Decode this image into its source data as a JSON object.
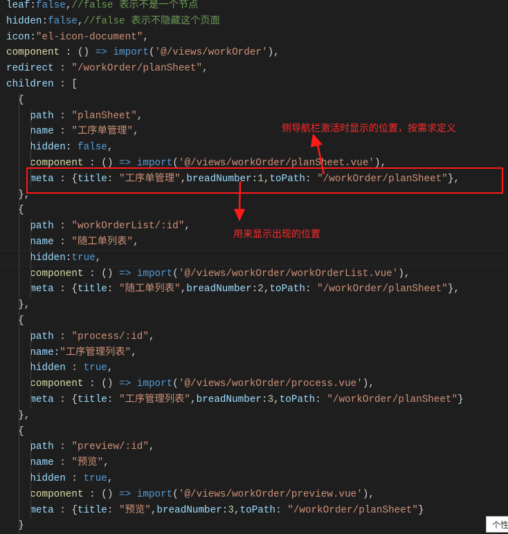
{
  "colors": {
    "background": "#1e1e1e",
    "annotation": "#ff1a1a"
  },
  "code_lines": [
    [
      [
        "key",
        "leaf"
      ],
      [
        "p",
        ":"
      ],
      [
        "kw",
        "false"
      ],
      [
        "p",
        ","
      ],
      [
        "cm",
        "//false 表示不是一个节点"
      ]
    ],
    [
      [
        "key",
        "hidden"
      ],
      [
        "p",
        ":"
      ],
      [
        "kw",
        "false"
      ],
      [
        "p",
        ","
      ],
      [
        "cm",
        "//false 表示不隐藏这个页面"
      ]
    ],
    [
      [
        "key",
        "icon"
      ],
      [
        "p",
        ":"
      ],
      [
        "str",
        "\"el-icon-document\""
      ],
      [
        "p",
        ","
      ]
    ],
    [
      [
        "fn",
        "component"
      ],
      [
        "p",
        " : () "
      ],
      [
        "kw",
        "=>"
      ],
      [
        "p",
        " "
      ],
      [
        "kw",
        "import"
      ],
      [
        "p",
        "("
      ],
      [
        "str",
        "'@/views/workOrder'"
      ],
      [
        "p",
        "),"
      ]
    ],
    [
      [
        "key",
        "redirect"
      ],
      [
        "p",
        " : "
      ],
      [
        "str",
        "\"/workOrder/planSheet\""
      ],
      [
        "p",
        ","
      ]
    ],
    [
      [
        "key",
        "children"
      ],
      [
        "p",
        " : ["
      ]
    ],
    [
      [
        "p",
        "  {"
      ]
    ],
    [
      [
        "p",
        "    "
      ],
      [
        "key",
        "path"
      ],
      [
        "p",
        " : "
      ],
      [
        "str",
        "\"planSheet\""
      ],
      [
        "p",
        ","
      ]
    ],
    [
      [
        "p",
        "    "
      ],
      [
        "key",
        "name"
      ],
      [
        "p",
        " : "
      ],
      [
        "str",
        "\"工序单管理\""
      ],
      [
        "p",
        ","
      ]
    ],
    [
      [
        "p",
        "    "
      ],
      [
        "key",
        "hidden"
      ],
      [
        "p",
        ": "
      ],
      [
        "kw",
        "false"
      ],
      [
        "p",
        ","
      ]
    ],
    [
      [
        "p",
        "    "
      ],
      [
        "fn",
        "component"
      ],
      [
        "p",
        " : () "
      ],
      [
        "kw",
        "=>"
      ],
      [
        "p",
        " "
      ],
      [
        "kw",
        "import"
      ],
      [
        "p",
        "("
      ],
      [
        "str",
        "'@/views/workOrder/planSheet.vue'"
      ],
      [
        "p",
        "),"
      ]
    ],
    [
      [
        "p",
        "    "
      ],
      [
        "key",
        "meta"
      ],
      [
        "p",
        " : {"
      ],
      [
        "key",
        "title"
      ],
      [
        "p",
        ": "
      ],
      [
        "str",
        "\"工序单管理\""
      ],
      [
        "p",
        ","
      ],
      [
        "key",
        "breadNumber"
      ],
      [
        "p",
        ":"
      ],
      [
        "num",
        "1"
      ],
      [
        "p",
        ","
      ],
      [
        "key",
        "toPath"
      ],
      [
        "p",
        ": "
      ],
      [
        "str",
        "\"/workOrder/planSheet\""
      ],
      [
        "p",
        "},"
      ]
    ],
    [
      [
        "p",
        "  },"
      ]
    ],
    [
      [
        "p",
        "  {"
      ]
    ],
    [
      [
        "p",
        "    "
      ],
      [
        "key",
        "path"
      ],
      [
        "p",
        " : "
      ],
      [
        "str",
        "\"workOrderList/:id\""
      ],
      [
        "p",
        ","
      ]
    ],
    [
      [
        "p",
        "    "
      ],
      [
        "key",
        "name"
      ],
      [
        "p",
        " : "
      ],
      [
        "str",
        "\"随工单列表\""
      ],
      [
        "p",
        ","
      ]
    ],
    [
      [
        "p",
        "    "
      ],
      [
        "key",
        "hidden"
      ],
      [
        "p",
        ":"
      ],
      [
        "kw",
        "true"
      ],
      [
        "p",
        ","
      ]
    ],
    [
      [
        "p",
        "    "
      ],
      [
        "fn",
        "component"
      ],
      [
        "p",
        " : () "
      ],
      [
        "kw",
        "=>"
      ],
      [
        "p",
        " "
      ],
      [
        "kw",
        "import"
      ],
      [
        "p",
        "("
      ],
      [
        "str",
        "'@/views/workOrder/workOrderList.vue'"
      ],
      [
        "p",
        "),"
      ]
    ],
    [
      [
        "p",
        "    "
      ],
      [
        "key",
        "meta"
      ],
      [
        "p",
        " : {"
      ],
      [
        "key",
        "title"
      ],
      [
        "p",
        ": "
      ],
      [
        "str",
        "\"随工单列表\""
      ],
      [
        "p",
        ","
      ],
      [
        "key",
        "breadNumber"
      ],
      [
        "p",
        ":"
      ],
      [
        "num",
        "2"
      ],
      [
        "p",
        ","
      ],
      [
        "key",
        "toPath"
      ],
      [
        "p",
        ": "
      ],
      [
        "str",
        "\"/workOrder/planSheet\""
      ],
      [
        "p",
        "},"
      ]
    ],
    [
      [
        "p",
        "  },"
      ]
    ],
    [
      [
        "p",
        "  {"
      ]
    ],
    [
      [
        "p",
        "    "
      ],
      [
        "key",
        "path"
      ],
      [
        "p",
        " : "
      ],
      [
        "str",
        "\"process/:id\""
      ],
      [
        "p",
        ","
      ]
    ],
    [
      [
        "p",
        "    "
      ],
      [
        "key",
        "name"
      ],
      [
        "p",
        ":"
      ],
      [
        "str",
        "\"工序管理列表\""
      ],
      [
        "p",
        ","
      ]
    ],
    [
      [
        "p",
        "    "
      ],
      [
        "key",
        "hidden"
      ],
      [
        "p",
        " : "
      ],
      [
        "kw",
        "true"
      ],
      [
        "p",
        ","
      ]
    ],
    [
      [
        "p",
        "    "
      ],
      [
        "fn",
        "component"
      ],
      [
        "p",
        " : () "
      ],
      [
        "kw",
        "=>"
      ],
      [
        "p",
        " "
      ],
      [
        "kw",
        "import"
      ],
      [
        "p",
        "("
      ],
      [
        "str",
        "'@/views/workOrder/process.vue'"
      ],
      [
        "p",
        "),"
      ]
    ],
    [
      [
        "p",
        "    "
      ],
      [
        "key",
        "meta"
      ],
      [
        "p",
        " : {"
      ],
      [
        "key",
        "title"
      ],
      [
        "p",
        ": "
      ],
      [
        "str",
        "\"工序管理列表\""
      ],
      [
        "p",
        ","
      ],
      [
        "key",
        "breadNumber"
      ],
      [
        "p",
        ":"
      ],
      [
        "num",
        "3"
      ],
      [
        "p",
        ","
      ],
      [
        "key",
        "toPath"
      ],
      [
        "p",
        ": "
      ],
      [
        "str",
        "\"/workOrder/planSheet\""
      ],
      [
        "p",
        "}"
      ]
    ],
    [
      [
        "p",
        "  },"
      ]
    ],
    [
      [
        "p",
        "  {"
      ]
    ],
    [
      [
        "p",
        "    "
      ],
      [
        "key",
        "path"
      ],
      [
        "p",
        " : "
      ],
      [
        "str",
        "\"preview/:id\""
      ],
      [
        "p",
        ","
      ]
    ],
    [
      [
        "p",
        "    "
      ],
      [
        "key",
        "name"
      ],
      [
        "p",
        " : "
      ],
      [
        "str",
        "\"预览\""
      ],
      [
        "p",
        ","
      ]
    ],
    [
      [
        "p",
        "    "
      ],
      [
        "key",
        "hidden"
      ],
      [
        "p",
        " : "
      ],
      [
        "kw",
        "true"
      ],
      [
        "p",
        ","
      ]
    ],
    [
      [
        "p",
        "    "
      ],
      [
        "fn",
        "component"
      ],
      [
        "p",
        " : () "
      ],
      [
        "kw",
        "=>"
      ],
      [
        "p",
        " "
      ],
      [
        "kw",
        "import"
      ],
      [
        "p",
        "("
      ],
      [
        "str",
        "'@/views/workOrder/preview.vue'"
      ],
      [
        "p",
        "),"
      ]
    ],
    [
      [
        "p",
        "    "
      ],
      [
        "key",
        "meta"
      ],
      [
        "p",
        " : {"
      ],
      [
        "key",
        "title"
      ],
      [
        "p",
        ": "
      ],
      [
        "str",
        "\"预览\""
      ],
      [
        "p",
        ","
      ],
      [
        "key",
        "breadNumber"
      ],
      [
        "p",
        ":"
      ],
      [
        "num",
        "3"
      ],
      [
        "p",
        ","
      ],
      [
        "key",
        "toPath"
      ],
      [
        "p",
        ": "
      ],
      [
        "str",
        "\"/workOrder/planSheet\""
      ],
      [
        "p",
        "}"
      ]
    ],
    [
      [
        "p",
        "  }"
      ]
    ]
  ],
  "annotations": {
    "top_note": "侧导航栏激活时显示的位置，按需求定义",
    "bottom_note": "用来显示出现的位置"
  },
  "tooltip": "个性"
}
